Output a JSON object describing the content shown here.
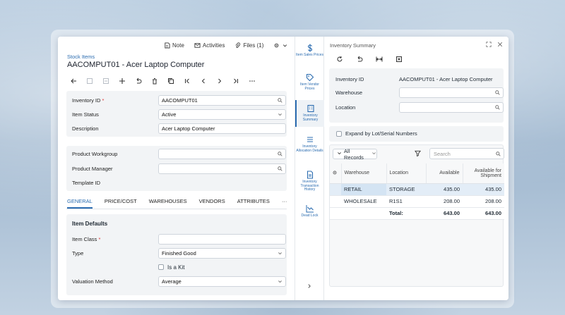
{
  "topbar": {
    "note": "Note",
    "activities": "Activities",
    "files": "Files (1)"
  },
  "breadcrumb": "Stock Items",
  "page_title": "AACOMPUT01 - Acer Laptop Computer",
  "form1": {
    "inventory_id_label": "Inventory ID",
    "inventory_id_value": "AACOMPUT01",
    "item_status_label": "Item Status",
    "item_status_value": "Active",
    "description_label": "Description",
    "description_value": "Acer Laptop Computer"
  },
  "form2": {
    "product_workgroup_label": "Product Workgroup",
    "product_manager_label": "Product Manager",
    "template_id_label": "Template ID"
  },
  "tabs": [
    "GENERAL",
    "PRICE/COST",
    "WAREHOUSES",
    "VENDORS",
    "ATTRIBUTES"
  ],
  "tabs_more": "···",
  "item_defaults": {
    "title": "Item Defaults",
    "item_class_label": "Item Class",
    "type_label": "Type",
    "type_value": "Finished Good",
    "is_kit_label": "Is a Kit",
    "valuation_label": "Valuation Method",
    "valuation_value": "Average"
  },
  "rail": [
    {
      "label": "Item Sales Prices"
    },
    {
      "label": "Item Vendor Prices"
    },
    {
      "label": "Inventory Summary"
    },
    {
      "label": "Inventory Allocation Details"
    },
    {
      "label": "Inventory Transaction History"
    },
    {
      "label": "Dead Lock"
    }
  ],
  "summary": {
    "title": "Inventory Summary",
    "inventory_id_label": "Inventory ID",
    "inventory_id_value": "AACOMPUT01 - Acer Laptop Computer",
    "warehouse_label": "Warehouse",
    "location_label": "Location",
    "expand_label": "Expand by Lot/Serial Numbers",
    "filter_label": "All Records",
    "search_placeholder": "Search",
    "columns": [
      "Warehouse",
      "Location",
      "Available",
      "Available for Shipment"
    ],
    "rows": [
      {
        "warehouse": "RETAIL",
        "location": "STORAGE",
        "available": "435.00",
        "shipment": "435.00"
      },
      {
        "warehouse": "WHOLESALE",
        "location": "R1S1",
        "available": "208.00",
        "shipment": "208.00"
      }
    ],
    "total_label": "Total:",
    "total_available": "643.00",
    "total_shipment": "643.00"
  }
}
